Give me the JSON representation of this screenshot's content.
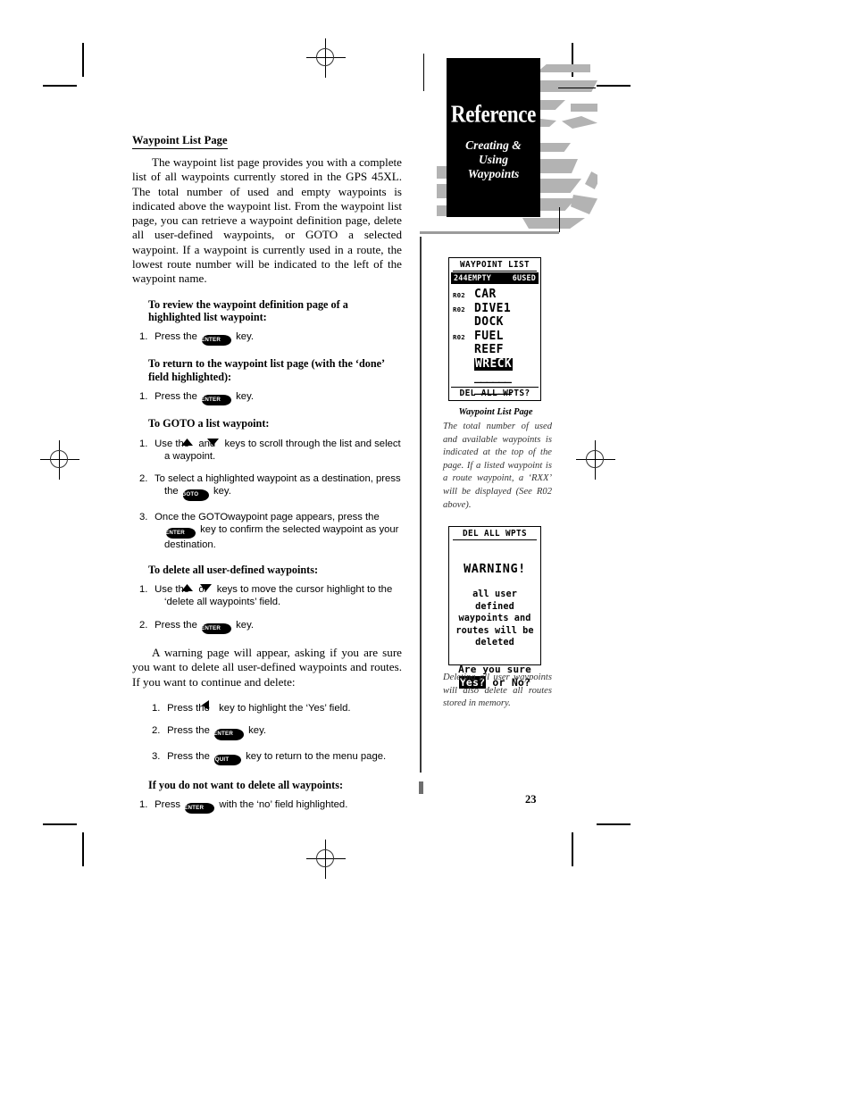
{
  "page": {
    "number": "23",
    "header": {
      "title": "Reference",
      "subtitle_lines": [
        "Creating &",
        "Using",
        "Waypoints"
      ]
    }
  },
  "main": {
    "section_heading": "Waypoint List Page",
    "intro_paragraph": "The waypoint list page provides you with a complete list of all waypoints currently stored in the GPS 45XL. The total number of used and empty waypoints is indicated above the waypoint list. From the waypoint list page, you can retrieve a waypoint definition page, delete all user-defined waypoints, or GOTO a selected waypoint. If a waypoint is currently used in a route, the lowest route number will be indicated to the left of the waypoint name.",
    "warning_paragraph": "A warning page will appear, asking if you are sure you want to delete all user-defined waypoints and routes. If you want to continue and delete:",
    "procedures": [
      {
        "heading": "To review the waypoint definition page of a highlighted list waypoint:",
        "steps": [
          {
            "num": "1.",
            "pre": "Press the",
            "key": "ENTER",
            "post": "key."
          }
        ]
      },
      {
        "heading": "To return to the waypoint list page (with the ‘done’ field highlighted):",
        "steps": [
          {
            "num": "1.",
            "pre": "Press the",
            "key": "ENTER",
            "post": "key."
          }
        ]
      },
      {
        "heading": "To GOTO a list waypoint:",
        "steps": [
          {
            "num": "1.",
            "pre": "Use the",
            "key": "UP-ARROW",
            "mid": "and",
            "key2": "DOWN-ARROW",
            "post": "keys to scroll through the list and select a waypoint."
          },
          {
            "num": "2.",
            "pre": "To select a highlighted waypoint as a destination, press the",
            "key": "GOTO",
            "post": "key."
          },
          {
            "num": "3.",
            "pre": "Once the GOTOwaypoint page appears, press the",
            "key": "ENTER",
            "post": "key to confirm the selected waypoint as your destination."
          }
        ]
      },
      {
        "heading": "To delete all user-defined waypoints:",
        "steps": [
          {
            "num": "1.",
            "pre": "Use the",
            "key": "UP-ARROW",
            "mid": "or",
            "key2": "DOWN-ARROW",
            "post": "keys to move the cursor highlight to the ‘delete all waypoints’ field."
          },
          {
            "num": "2.",
            "pre": "Press the",
            "key": "ENTER",
            "post": "key."
          }
        ]
      },
      {
        "heading": "",
        "steps": [
          {
            "num": "1.",
            "pre": "Press the",
            "key": "LEFT-ARROW",
            "post": "key to highlight the ‘Yes’ field."
          },
          {
            "num": "2.",
            "pre": "Press the",
            "key": "ENTER",
            "post": "key."
          },
          {
            "num": "3.",
            "pre": "Press the",
            "key": "QUIT",
            "post": "key to return to the menu page."
          }
        ]
      },
      {
        "heading": "If you do not want to delete all waypoints:",
        "steps": [
          {
            "num": "1.",
            "pre": "Press",
            "key": "ENTER",
            "post": "with the ‘no’ field highlighted."
          }
        ]
      }
    ]
  },
  "sidebar": {
    "lcd_waypoint_list": {
      "title": "WAYPOINT LIST",
      "empty_count": "244EMPTY",
      "used_count": "6USED",
      "rows": [
        {
          "route": "R02",
          "name": "CAR",
          "highlighted": false
        },
        {
          "route": "R02",
          "name": "DIVE1",
          "highlighted": false
        },
        {
          "route": "",
          "name": "DOCK",
          "highlighted": false
        },
        {
          "route": "R02",
          "name": "FUEL",
          "highlighted": false
        },
        {
          "route": "",
          "name": "REEF",
          "highlighted": false
        },
        {
          "route": "",
          "name": "WRECK",
          "highlighted": true
        }
      ],
      "empty_rows": [
        "______",
        "______"
      ],
      "footer": "DEL ALL WPTS?"
    },
    "caption_1_title": "Waypoint List Page",
    "caption_1_text": "The total number of used and available waypoints is indicated at the top of the page. If a listed waypoint is a route waypoint, a ‘RXX’ will be displayed (See R02 above).",
    "lcd_warning": {
      "title": "DEL ALL WPTS",
      "warning": "WARNING!",
      "body_lines": [
        "all user defined",
        "waypoints and",
        "routes will be",
        "deleted"
      ],
      "question": "Are you sure",
      "answer_yes": "Yes?",
      "answer_or": " or ",
      "answer_no": "No?"
    },
    "caption_2_text": "Deleting all user waypoints will also delete all routes stored in memory."
  }
}
